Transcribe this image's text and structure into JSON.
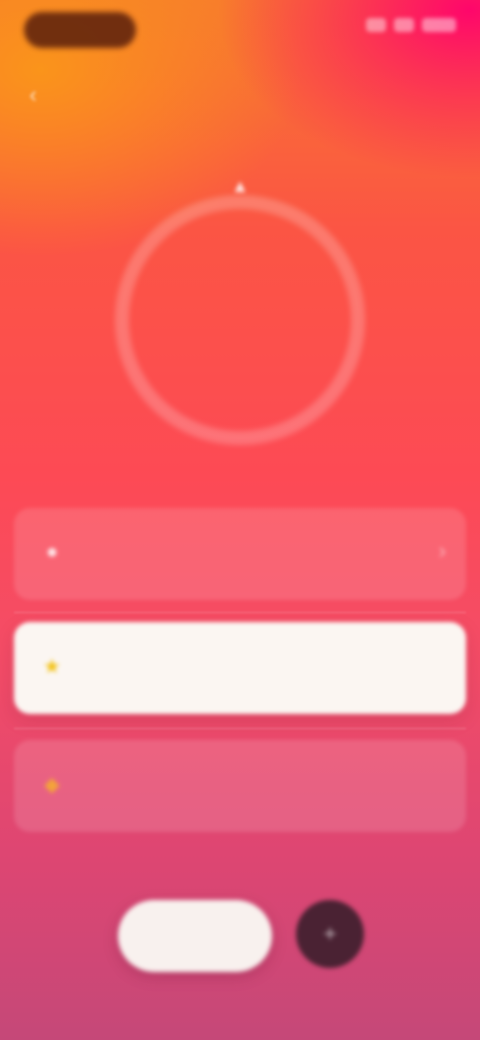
{
  "header": {
    "title": "",
    "back_icon": "chevron-left-icon"
  },
  "ring": {
    "top_icon": "flame-icon",
    "line1": "",
    "line2": "",
    "progress": 0
  },
  "rows": [
    {
      "icon": "person-icon",
      "title": "",
      "subtitle": "",
      "value": ""
    },
    {
      "icon": "star-icon",
      "title": "",
      "subtitle": "",
      "value": ""
    },
    {
      "icon": "bolt-icon",
      "title": "",
      "subtitle": "",
      "value": ""
    }
  ],
  "controls": {
    "primary_label": "",
    "secondary_icon": "plus-icon"
  },
  "colors": {
    "gradient_top": "#f7782f",
    "gradient_mid": "#fd4a55",
    "gradient_bottom": "#c54878",
    "accent_pink": "#ff006e",
    "highlight_row": "#fbf6f2",
    "round_button": "#4a2233"
  }
}
